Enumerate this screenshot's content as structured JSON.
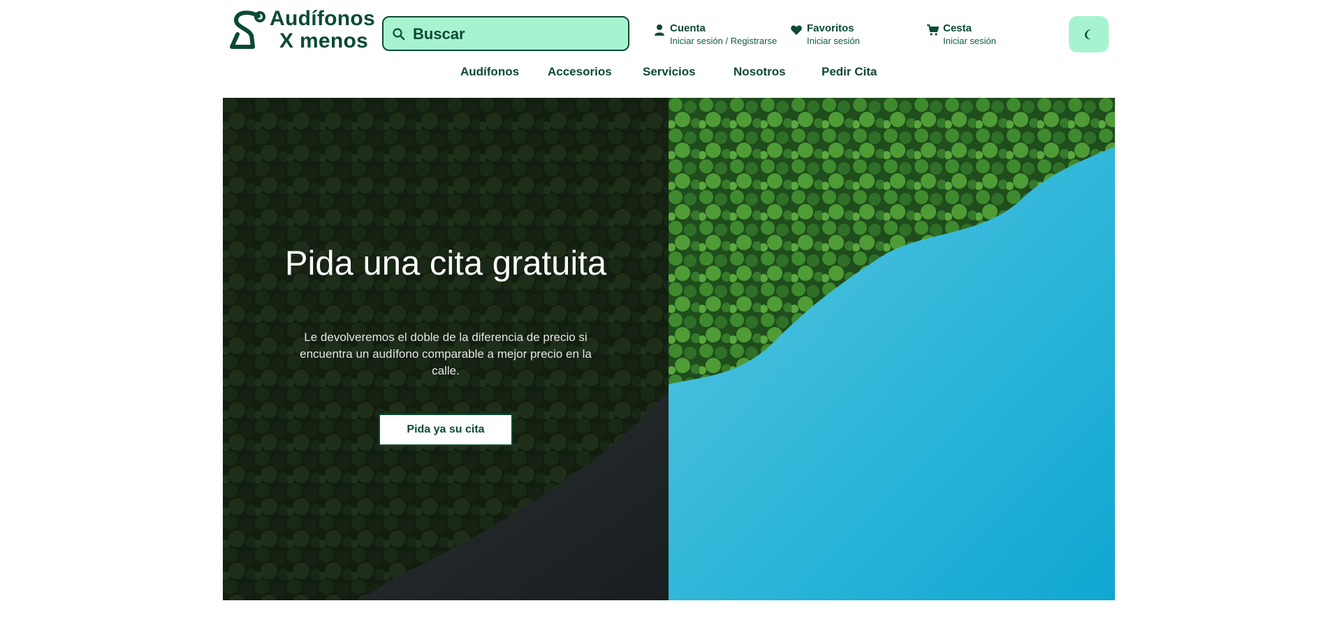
{
  "header": {
    "logo": {
      "line1": "Audífonos",
      "line2": "X menos"
    },
    "search": {
      "placeholder": "Buscar"
    },
    "account": {
      "title": "Cuenta",
      "subtitle": "Iniciar sesión / Registrarse"
    },
    "favorites": {
      "title": "Favoritos",
      "subtitle": "Iniciar sesión"
    },
    "cart": {
      "title": "Cesta",
      "subtitle": "Iniciar sesión"
    },
    "theme_toggle_icon": "moon-icon",
    "nav": [
      {
        "label": "Audífonos"
      },
      {
        "label": "Accesorios"
      },
      {
        "label": "Servicios"
      },
      {
        "label": "Nosotros"
      },
      {
        "label": "Pedir Cita"
      }
    ]
  },
  "hero": {
    "title": "Pida una cita gratuita",
    "subtitle": "Le devolveremos el doble de la diferencia de precio si encuentra un audífono comparable a mejor precio en la calle.",
    "cta": "Pida ya su cita"
  },
  "colors": {
    "brand": "#0b4a33",
    "accent": "#a7f3d0",
    "water": "#29b3d8",
    "forest": "#2d6b2a"
  }
}
